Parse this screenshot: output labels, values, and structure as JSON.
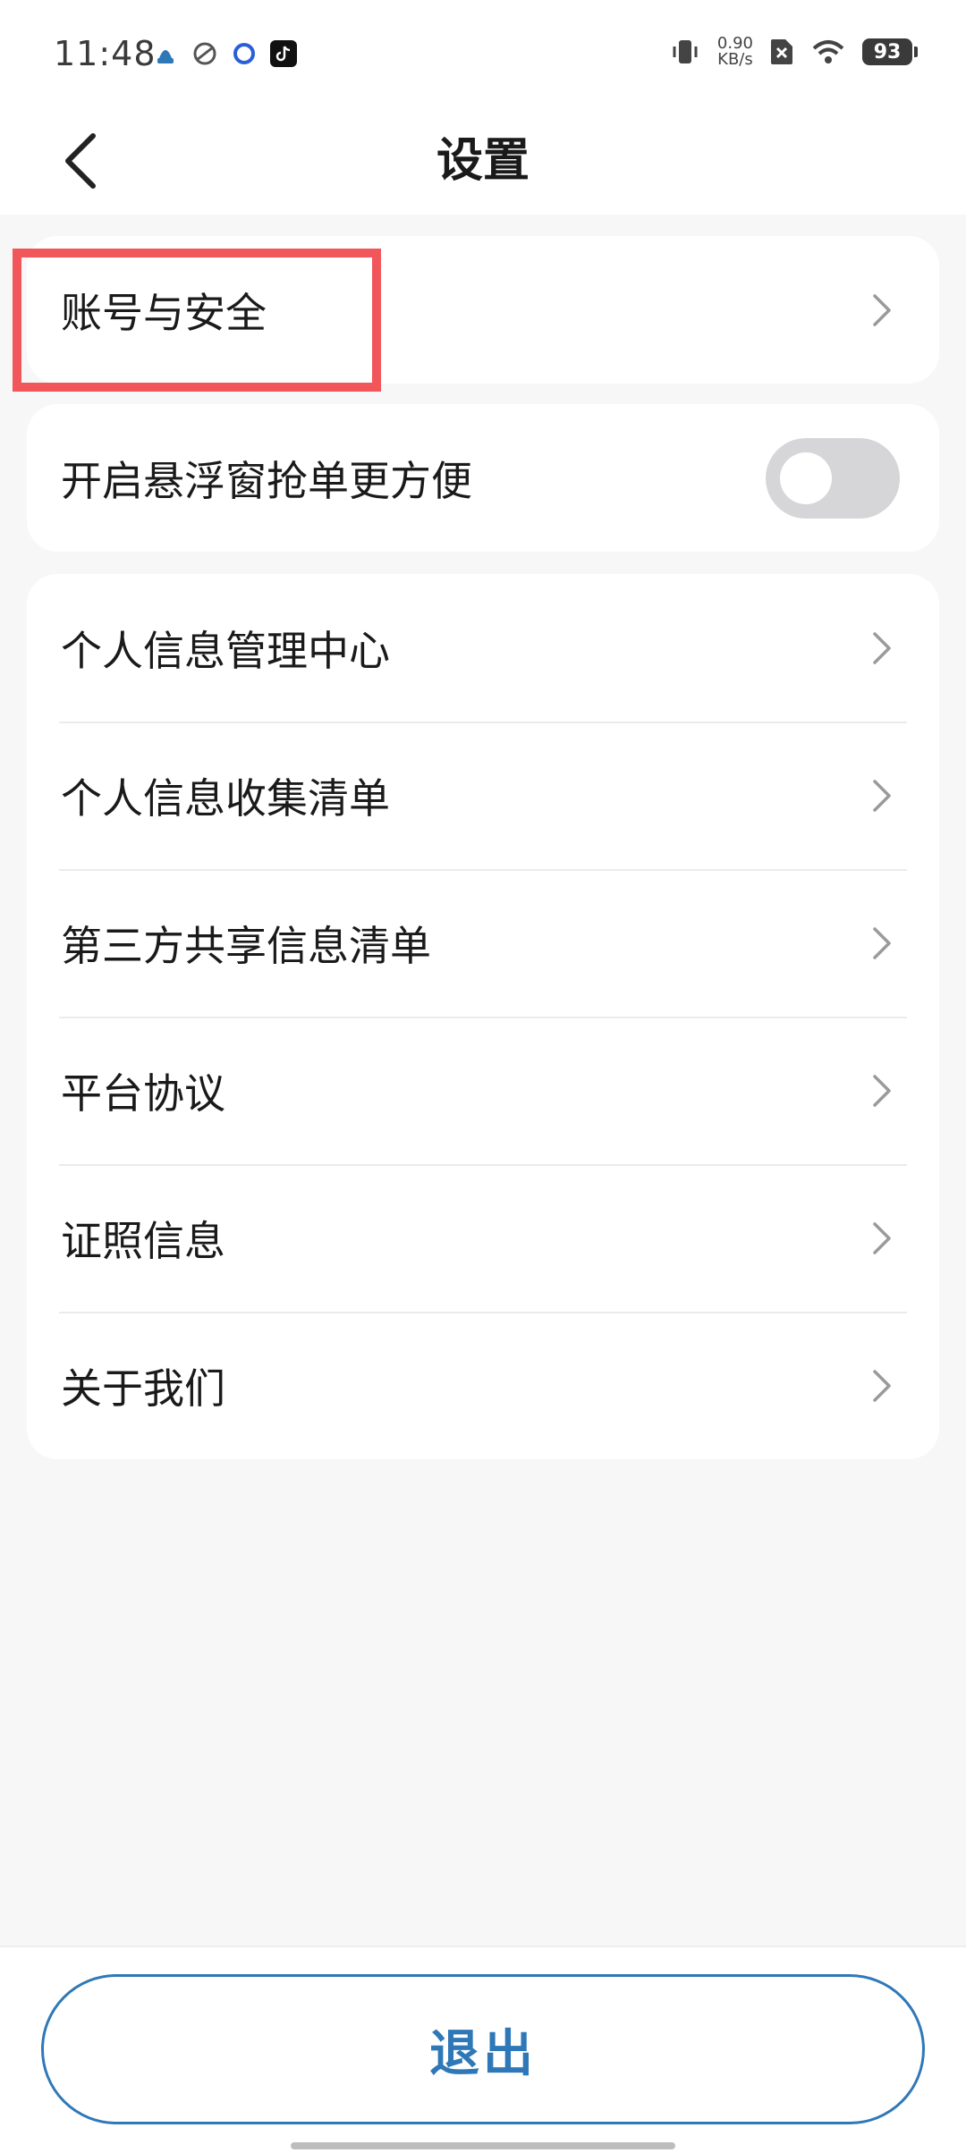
{
  "status_bar": {
    "time": "11:48",
    "net_speed_value": "0.90",
    "net_speed_unit": "KB/s",
    "battery": "93"
  },
  "header": {
    "title": "设置"
  },
  "card_account": {
    "label": "账号与安全"
  },
  "card_float": {
    "label": "开启悬浮窗抢单更方便",
    "toggle_on": false
  },
  "card_info": {
    "items": [
      {
        "label": "个人信息管理中心"
      },
      {
        "label": "个人信息收集清单"
      },
      {
        "label": "第三方共享信息清单"
      },
      {
        "label": "平台协议"
      },
      {
        "label": "证照信息"
      },
      {
        "label": "关于我们"
      }
    ]
  },
  "footer": {
    "logout_label": "退出"
  },
  "colors": {
    "accent": "#2f78b7",
    "highlight": "#f0565a",
    "background": "#f7f7f7"
  }
}
